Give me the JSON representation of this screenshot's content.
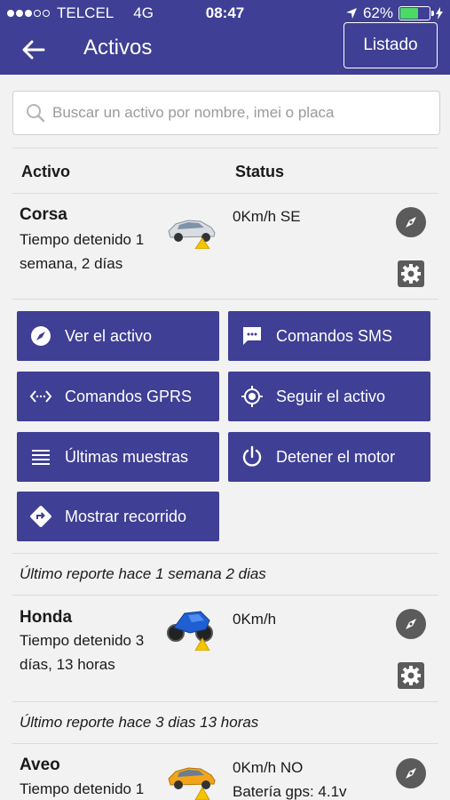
{
  "statusbar": {
    "carrier": "TELCEL",
    "network": "4G",
    "time": "08:47",
    "battery": "62%"
  },
  "header": {
    "title": "Activos",
    "listado_label": "Listado"
  },
  "search": {
    "placeholder": "Buscar un activo por nombre, imei o placa"
  },
  "table": {
    "col_activo": "Activo",
    "col_status": "Status"
  },
  "assets": [
    {
      "name": "Corsa",
      "detail": "Tiempo detenido 1 semana, 2 días",
      "status": "0Km/h SE",
      "status2": ""
    },
    {
      "name": "Honda",
      "detail": "Tiempo detenido 3 días, 13 horas",
      "status": "0Km/h",
      "status2": "",
      "report": "Último reporte hace 3 dias 13 horas"
    },
    {
      "name": "Aveo",
      "detail": "Tiempo detenido 1",
      "status": "0Km/h NO",
      "status2": "Batería gps: 4.1v"
    }
  ],
  "actions": {
    "ver": "Ver el activo",
    "sms": "Comandos SMS",
    "gprs": "Comandos GPRS",
    "seguir": "Seguir el activo",
    "muestras": "Últimas muestras",
    "detener": "Detener el motor",
    "recorrido": "Mostrar recorrido"
  },
  "report1": "Último reporte hace 1 semana 2 dias",
  "colors": {
    "primary": "#3f3f95",
    "warning": "#f5c400",
    "icon_gray": "#5b5b5b"
  }
}
